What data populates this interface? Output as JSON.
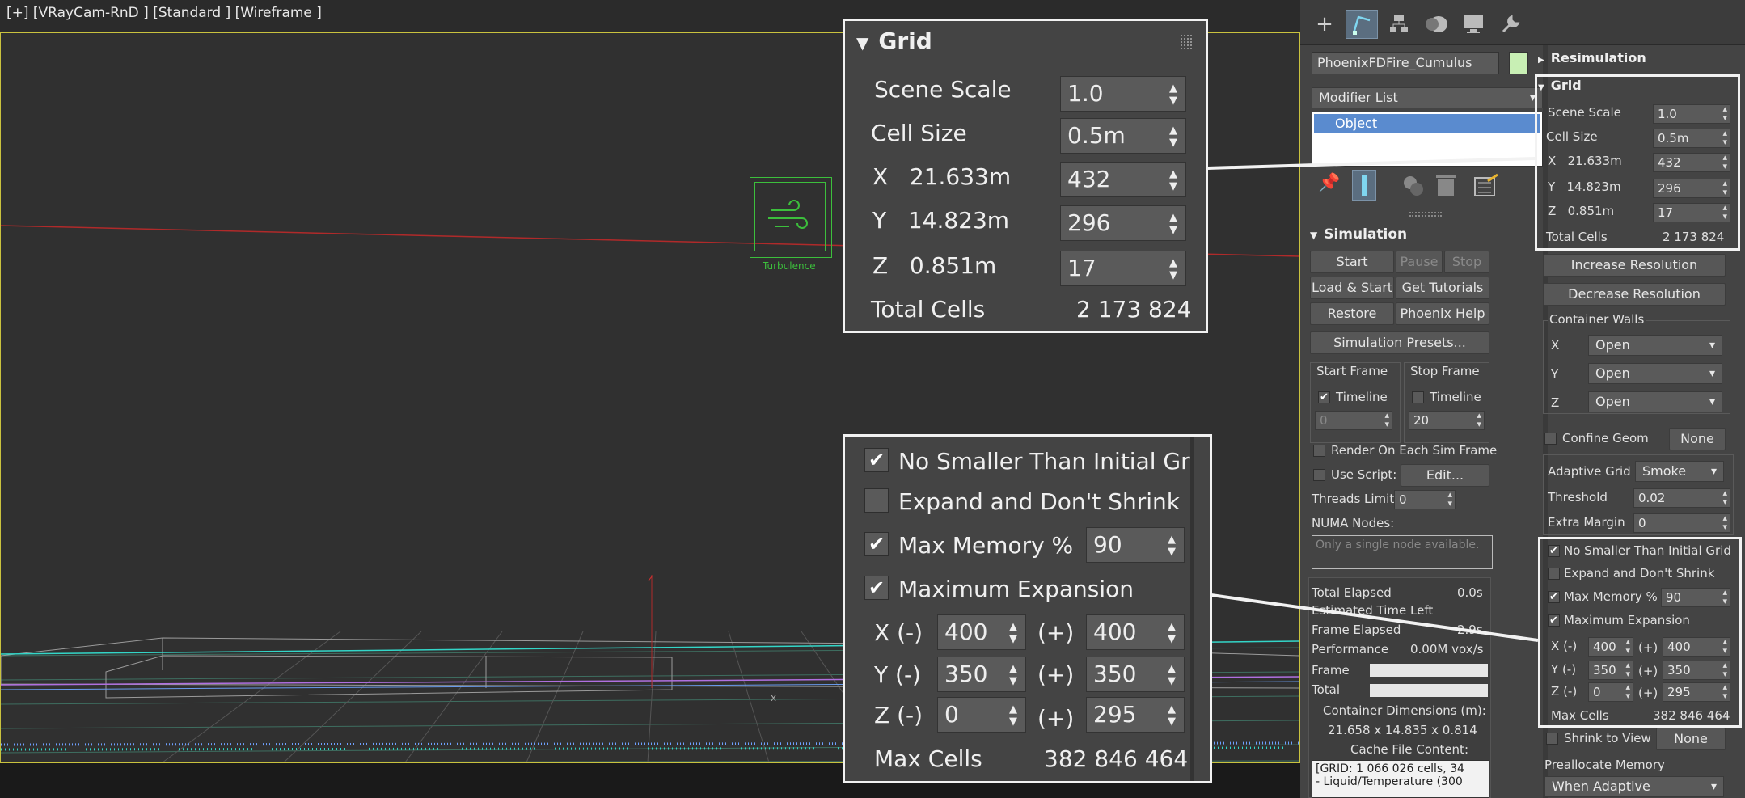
{
  "viewport": {
    "label": "[+] [VRayCam-RnD ] [Standard ] [Wireframe ]",
    "helper_label": "Turbulence",
    "axis_z": "z",
    "axis_x": "x"
  },
  "toolbar": {
    "icons": [
      "create-icon",
      "modify-icon",
      "hierarchy-icon",
      "motion-icon",
      "display-icon",
      "utilities-icon"
    ],
    "plus": "+"
  },
  "object": {
    "name": "PhoenixFDFire_Cumulus",
    "color": "#c8efb4"
  },
  "modifier_list": {
    "label": "Modifier List",
    "selected": "Object"
  },
  "simulation": {
    "title": "Simulation",
    "start": "Start",
    "pause": "Pause",
    "stop": "Stop",
    "load_start": "Load & Start",
    "get_tutorials": "Get Tutorials",
    "restore": "Restore",
    "phoenix_help": "Phoenix Help",
    "presets": "Simulation Presets...",
    "start_frame": {
      "title": "Start Frame",
      "timeline": "Timeline",
      "value": "0",
      "checked": true
    },
    "stop_frame": {
      "title": "Stop Frame",
      "timeline": "Timeline",
      "value": "20",
      "checked": false
    },
    "render_each": "Render On Each Sim Frame",
    "use_script": "Use Script:",
    "edit": "Edit...",
    "threads_label": "Threads Limit",
    "threads_value": "0",
    "numa_label": "NUMA Nodes:",
    "numa_placeholder": "Only a single node available.",
    "stats": {
      "total_elapsed": "Total Elapsed",
      "total_elapsed_value": "0.0s",
      "time_left": "Estimated Time Left",
      "frame_elapsed": "Frame Elapsed",
      "frame_elapsed_value": "2.9s",
      "performance": "Performance",
      "performance_value": "0.00M vox/s",
      "frame": "Frame",
      "total": "Total",
      "container_dims": "Container Dimensions (m):",
      "container_dims_value": "21.658 x 14.835 x 0.814",
      "cache_content": "Cache File Content:",
      "cache_line1": "[GRID: 1 066 026 cells, 34",
      "cache_line2": "- Liquid/Temperature (300"
    }
  },
  "resimulation": {
    "title": "Resimulation"
  },
  "grid": {
    "title": "Grid",
    "scene_scale_label": "Scene Scale",
    "scene_scale": "1.0",
    "cell_size_label": "Cell Size",
    "cell_size": "0.5m",
    "x_label": "X",
    "x_size": "21.633m",
    "x_cells": "432",
    "y_label": "Y",
    "y_size": "14.823m",
    "y_cells": "296",
    "z_label": "Z",
    "z_size": "0.851m",
    "z_cells": "17",
    "total_cells_label": "Total Cells",
    "total_cells": "2 173 824",
    "increase_res": "Increase Resolution",
    "decrease_res": "Decrease Resolution",
    "walls_title": "Container Walls",
    "walls": [
      {
        "axis": "X",
        "value": "Open"
      },
      {
        "axis": "Y",
        "value": "Open"
      },
      {
        "axis": "Z",
        "value": "Open"
      }
    ],
    "confine_geom": "Confine Geom",
    "none": "None",
    "adaptive_grid_label": "Adaptive Grid",
    "adaptive_grid": "Smoke",
    "threshold_label": "Threshold",
    "threshold": "0.02",
    "extra_margin_label": "Extra Margin",
    "extra_margin": "0",
    "no_smaller": "No Smaller Than Initial Grid",
    "expand_dont_shrink": "Expand and Don't Shrink",
    "max_memory_label": "Max Memory %",
    "max_memory": "90",
    "max_expansion": "Maximum Expansion",
    "minus": "(-)",
    "plus": "(+)",
    "xm": "400",
    "xp": "400",
    "ym": "350",
    "yp": "350",
    "zm": "0",
    "zp": "295",
    "max_cells_label": "Max Cells",
    "max_cells": "382 846 464",
    "shrink_to_view": "Shrink to View",
    "preallocate_label": "Preallocate Memory",
    "preallocate": "When Adaptive"
  }
}
